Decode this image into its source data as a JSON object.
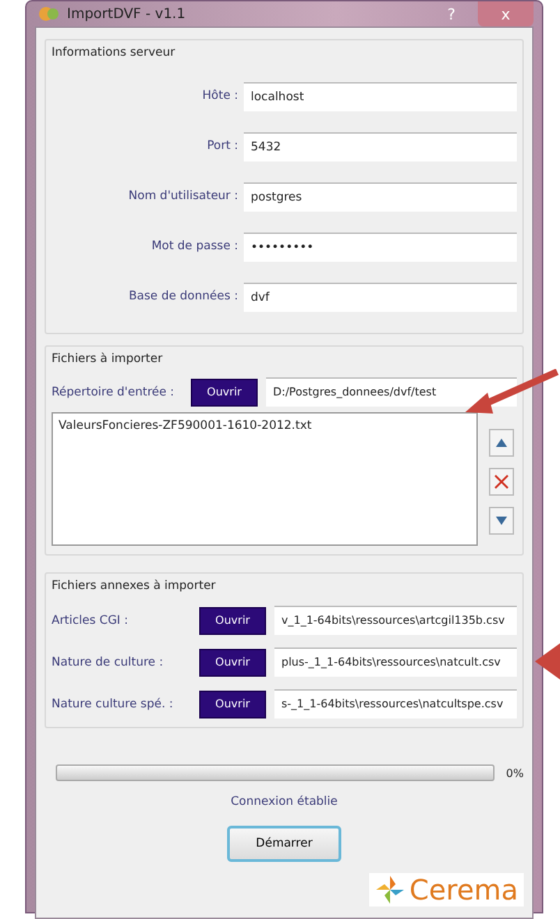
{
  "window": {
    "title": "ImportDVF - v1.1",
    "help_button": "?",
    "close_button": "x"
  },
  "server": {
    "title": "Informations serveur",
    "fields": [
      {
        "label": "Hôte :",
        "value": "localhost"
      },
      {
        "label": "Port :",
        "value": "5432"
      },
      {
        "label": "Nom d'utilisateur :",
        "value": "postgres"
      },
      {
        "label": "Mot de passe :",
        "value": "•••••••••"
      },
      {
        "label": "Base de données :",
        "value": "dvf"
      }
    ]
  },
  "import": {
    "title": "Fichiers à importer",
    "label": "Répertoire d'entrée :",
    "button": "Ouvrir",
    "path": "D:/Postgres_donnees/dvf/test",
    "files": [
      "ValeursFoncieres-ZF590001-1610-2012.txt"
    ]
  },
  "annexes": {
    "title": "Fichiers annexes à importer",
    "rows": [
      {
        "label": "Articles CGI :",
        "button": "Ouvrir",
        "path": "v_1_1-64bits\\ressources\\artcgil135b.csv"
      },
      {
        "label": "Nature de culture :",
        "button": "Ouvrir",
        "path": "plus-_1_1-64bits\\ressources\\natcult.csv"
      },
      {
        "label": "Nature culture spé. :",
        "button": "Ouvrir",
        "path": "s-_1_1-64bits\\ressources\\natcultspe.csv"
      }
    ]
  },
  "progress": {
    "level": 0,
    "reading": "0%"
  },
  "status": "Connexion établie",
  "start_button": "Démarrer",
  "logo": "Cerema"
}
